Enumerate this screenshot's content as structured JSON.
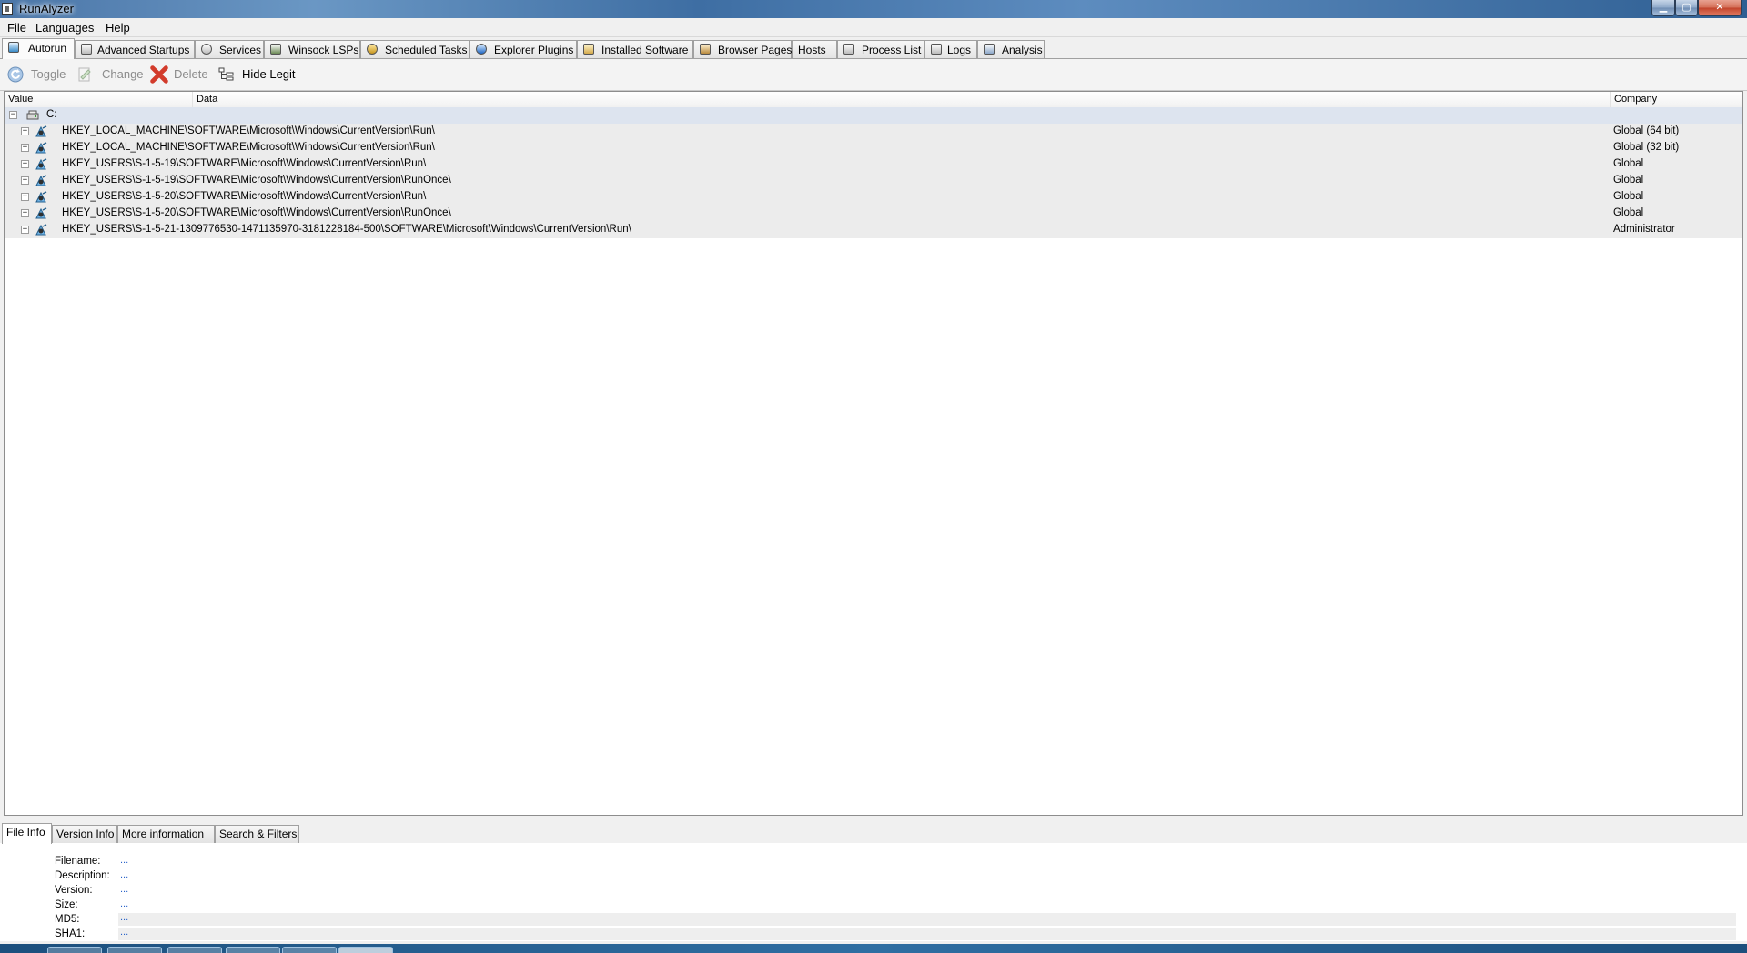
{
  "window": {
    "title": "RunAlyzer"
  },
  "menu": [
    "File",
    "Languages",
    "Help"
  ],
  "tabs": [
    {
      "label": "Autorun",
      "icon": "autorun-icon",
      "active": true
    },
    {
      "label": "Advanced Startups",
      "icon": "advanced-startups-icon"
    },
    {
      "label": "Services",
      "icon": "services-gear-icon"
    },
    {
      "label": "Winsock LSPs",
      "icon": "network-icon"
    },
    {
      "label": "Scheduled Tasks",
      "icon": "clock-icon"
    },
    {
      "label": "Explorer Plugins",
      "icon": "internet-explorer-icon"
    },
    {
      "label": "Installed Software",
      "icon": "software-box-icon"
    },
    {
      "label": "Browser Pages",
      "icon": "home-page-icon"
    },
    {
      "label": "Hosts",
      "icon": ""
    },
    {
      "label": "Process List",
      "icon": "process-list-icon"
    },
    {
      "label": "Logs",
      "icon": "log-icon"
    },
    {
      "label": "Analysis",
      "icon": "analysis-icon"
    }
  ],
  "toolbar": {
    "toggle": "Toggle",
    "change": "Change",
    "delete": "Delete",
    "hide_legit": "Hide Legit"
  },
  "tree": {
    "columns": [
      "Value",
      "Data",
      "Company"
    ],
    "root": "C:",
    "rows": [
      {
        "path": "HKEY_LOCAL_MACHINE\\SOFTWARE\\Microsoft\\Windows\\CurrentVersion\\Run\\",
        "company": "Global (64 bit)"
      },
      {
        "path": "HKEY_LOCAL_MACHINE\\SOFTWARE\\Microsoft\\Windows\\CurrentVersion\\Run\\",
        "company": "Global (32 bit)"
      },
      {
        "path": "HKEY_USERS\\S-1-5-19\\SOFTWARE\\Microsoft\\Windows\\CurrentVersion\\Run\\",
        "company": "Global"
      },
      {
        "path": "HKEY_USERS\\S-1-5-19\\SOFTWARE\\Microsoft\\Windows\\CurrentVersion\\RunOnce\\",
        "company": "Global"
      },
      {
        "path": "HKEY_USERS\\S-1-5-20\\SOFTWARE\\Microsoft\\Windows\\CurrentVersion\\Run\\",
        "company": "Global"
      },
      {
        "path": "HKEY_USERS\\S-1-5-20\\SOFTWARE\\Microsoft\\Windows\\CurrentVersion\\RunOnce\\",
        "company": "Global"
      },
      {
        "path": "HKEY_USERS\\S-1-5-21-1309776530-1471135970-3181228184-500\\SOFTWARE\\Microsoft\\Windows\\CurrentVersion\\Run\\",
        "company": "Administrator"
      }
    ]
  },
  "bottom_tabs": [
    "File Info",
    "Version Info",
    "More information",
    "Search & Filters"
  ],
  "file_info": [
    {
      "label": "Filename:",
      "value": "..."
    },
    {
      "label": "Description:",
      "value": "..."
    },
    {
      "label": "Version:",
      "value": "..."
    },
    {
      "label": "Size:",
      "value": "..."
    },
    {
      "label": "MD5:",
      "value": "..."
    },
    {
      "label": "SHA1:",
      "value": "..."
    }
  ],
  "colors": {
    "accent": "#2a63c9",
    "delete_red": "#d23b2b",
    "tree_row_bg": "#ececec",
    "root_row_bg": "#dde4ef"
  }
}
